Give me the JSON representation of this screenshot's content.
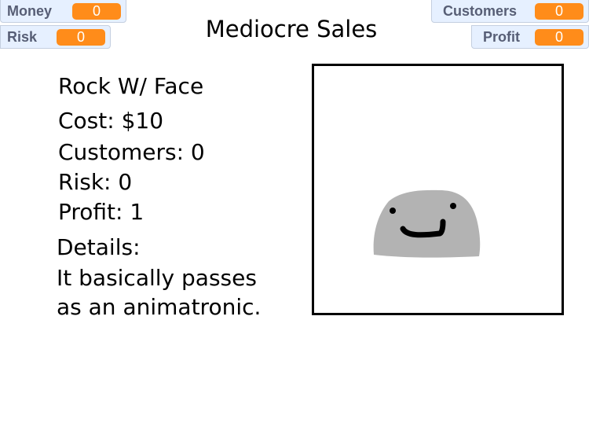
{
  "monitors": {
    "money": {
      "label": "Money",
      "value": "0"
    },
    "risk": {
      "label": "Risk",
      "value": "0"
    },
    "customers": {
      "label": "Customers",
      "value": "0"
    },
    "profit": {
      "label": "Profit",
      "value": "0"
    }
  },
  "title": "Mediocre Sales",
  "item": {
    "name": "Rock W/ Face",
    "cost": "Cost: $10",
    "customers": "Customers: 0",
    "risk": "Risk: 0",
    "profit": "Profit: 1",
    "details_label": "Details:",
    "details_line1": "It basically passes",
    "details_line2": "as an animatronic."
  },
  "colors": {
    "monitor_value": "#ff8c1a",
    "rock": "#b3b3b3"
  }
}
